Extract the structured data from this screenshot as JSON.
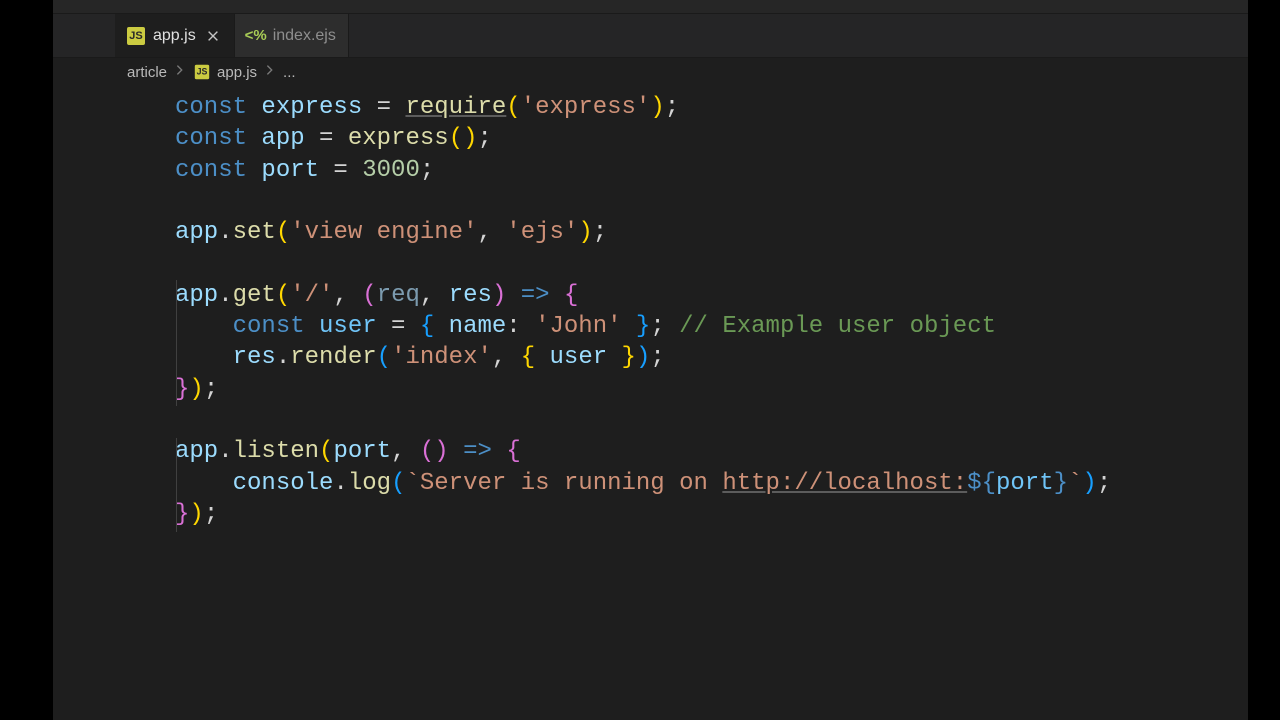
{
  "tabs": [
    {
      "label": "app.js",
      "icon": "JS",
      "active": true,
      "closeable": true
    },
    {
      "label": "index.ejs",
      "icon": "<%",
      "active": false,
      "closeable": false
    }
  ],
  "breadcrumbs": {
    "segments": [
      "article",
      "app.js",
      "..."
    ],
    "file_icon": "JS"
  },
  "code": {
    "lines": [
      "const express = require('express');",
      "const app = express();",
      "const port = 3000;",
      "",
      "app.set('view engine', 'ejs');",
      "",
      "app.get('/', (req, res) => {",
      "    const user = { name: 'John' }; // Example user object",
      "    res.render('index', { user });",
      "});",
      "",
      "app.listen(port, () => {",
      "    console.log(`Server is running on http://localhost:${port}`);",
      "});"
    ],
    "tokens": {
      "keywords": [
        "const"
      ],
      "identifiers": [
        "express",
        "app",
        "port",
        "req",
        "res",
        "user",
        "name",
        "console"
      ],
      "functions": [
        "require",
        "express",
        "set",
        "get",
        "render",
        "listen",
        "log"
      ],
      "strings": [
        "'express'",
        "'view engine'",
        "'ejs'",
        "'/'",
        "'John'",
        "'index'",
        "`Server is running on http://localhost:${port}`"
      ],
      "numbers": [
        "3000"
      ],
      "comments": [
        "// Example user object"
      ],
      "url": "http://localhost:"
    }
  }
}
